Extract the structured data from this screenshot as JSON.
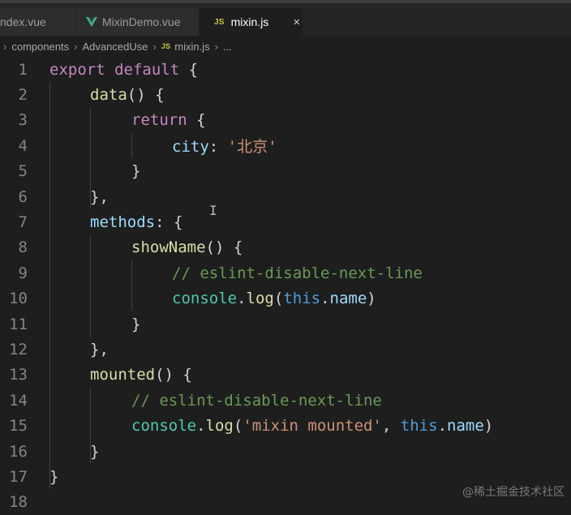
{
  "tabs": [
    {
      "label": "ndex.vue",
      "icon": "none",
      "active": false
    },
    {
      "label": "MixinDemo.vue",
      "icon": "vue-icon",
      "active": false
    },
    {
      "label": "mixin.js",
      "icon": "js-icon",
      "active": true
    }
  ],
  "js_badge": "JS",
  "close_glyph": "×",
  "breadcrumb": {
    "items": [
      "components",
      "AdvancedUse",
      "mixin.js",
      "..."
    ]
  },
  "line_numbers": [
    "1",
    "2",
    "3",
    "4",
    "5",
    "6",
    "7",
    "8",
    "9",
    "10",
    "11",
    "12",
    "13",
    "14",
    "15",
    "16",
    "17",
    "18"
  ],
  "code": {
    "l1": {
      "a": "export",
      "b": " default ",
      "c": "{"
    },
    "l2": {
      "a": "data",
      "b": "() {"
    },
    "l3": {
      "a": "return",
      "b": " {"
    },
    "l4": {
      "a": "city",
      "b": ": ",
      "c": "'北京'"
    },
    "l5": {
      "a": "}"
    },
    "l6": {
      "a": "},"
    },
    "l7": {
      "a": "methods",
      "b": ": {"
    },
    "l8": {
      "a": "showName",
      "b": "() {"
    },
    "l9": {
      "a": "// eslint-disable-next-line"
    },
    "l10": {
      "a": "console",
      "b": ".",
      "c": "log",
      "d": "(",
      "e": "this",
      "f": ".",
      "g": "name",
      "h": ")"
    },
    "l11": {
      "a": "}"
    },
    "l12": {
      "a": "},"
    },
    "l13": {
      "a": "mounted",
      "b": "() {"
    },
    "l14": {
      "a": "// eslint-disable-next-line"
    },
    "l15": {
      "a": "console",
      "b": ".",
      "c": "log",
      "d": "(",
      "e": "'mixin mounted'",
      "f": ", ",
      "g": "this",
      "h": ".",
      "i": "name",
      "j": ")"
    },
    "l16": {
      "a": "}"
    },
    "l17": {
      "a": "}"
    }
  },
  "cursor_glyph": "I",
  "watermark": "@稀土掘金技术社区",
  "colors": {
    "background": "#1e1e1e",
    "keyword": "#c586c0",
    "function": "#dcdcaa",
    "property": "#9cdcfe",
    "string": "#ce9178",
    "comment": "#6a9955",
    "this": "#569cd6",
    "vue": "#41b883",
    "js": "#cbcb41"
  }
}
